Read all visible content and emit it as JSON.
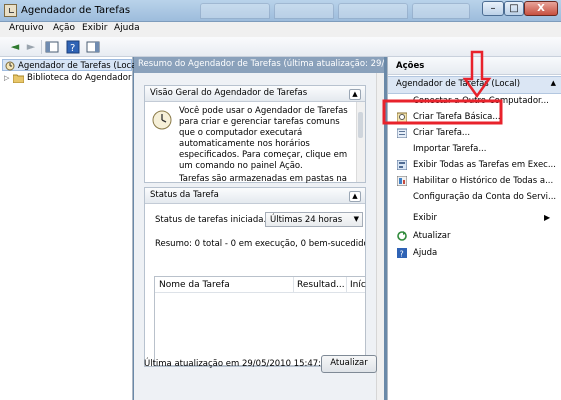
{
  "window": {
    "title": "Agendador de Tarefas",
    "minimize": "–",
    "maximize": "□",
    "close": "X"
  },
  "menu": [
    "Arquivo",
    "Ação",
    "Exibir",
    "Ajuda"
  ],
  "toolbar": {
    "back": "◄",
    "forward": "►"
  },
  "tree": {
    "root": "Agendador de Tarefas (Local)",
    "child": "Biblioteca do Agendador"
  },
  "center": {
    "summary": "Resumo do Agendador de Tarefas (última atualização: 29/05/2010 15",
    "overview": {
      "title": "Visão Geral do Agendador de Tarefas",
      "text": "Você pode usar o Agendador de Tarefas para criar e gerenciar tarefas comuns que o computador executará automaticamente nos horários especificados. Para começar, clique em um comando no painel Ação.",
      "text2": "Tarefas são armazenadas em pastas na"
    },
    "status": {
      "title": "Status da Tarefa",
      "filter_label": "Status de tarefas iniciada...",
      "filter_value": "Últimas 24 horas",
      "summary": "Resumo: 0 total - 0 em execução, 0 bem-sucedido, 0 i",
      "columns": [
        "Nome da Tarefa",
        "Resultad...",
        "Iníc"
      ]
    },
    "footer": {
      "last_update": "Última atualização em 29/05/2010 15:47:46",
      "refresh": "Atualizar"
    }
  },
  "actions": {
    "header": "Ações",
    "group": "Agendador de Tarefas (Local)",
    "items": [
      {
        "label": "Conectar a Outro Computador..."
      },
      {
        "label": "Criar Tarefa Básica..."
      },
      {
        "label": "Criar Tarefa..."
      },
      {
        "label": "Importar Tarefa..."
      },
      {
        "label": "Exibir Todas as Tarefas em Exec..."
      },
      {
        "label": "Habilitar o Histórico de Todas a..."
      },
      {
        "label": "Configuração da Conta do Servi..."
      },
      {
        "label": "Exibir"
      },
      {
        "label": "Atualizar"
      },
      {
        "label": "Ajuda"
      }
    ]
  },
  "colors": {
    "highlight": "#e8222b",
    "panel_header": "#dbe6f4",
    "summary_bar": "#8aa1bb"
  }
}
